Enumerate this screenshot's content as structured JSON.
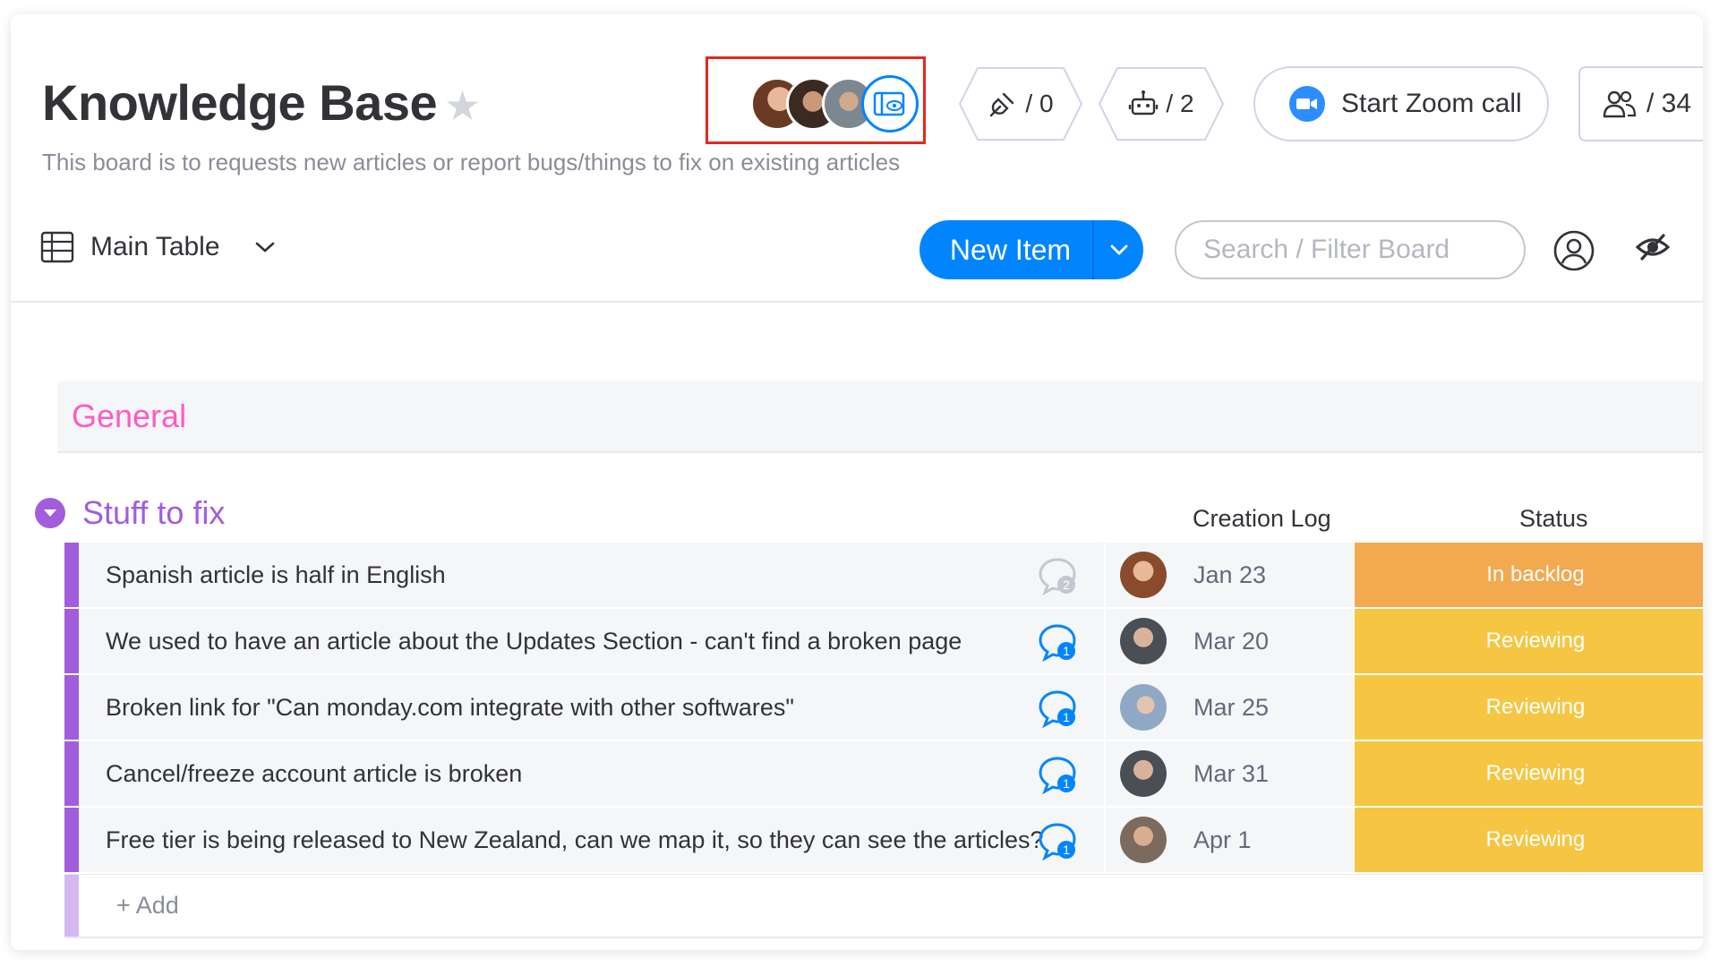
{
  "board": {
    "title": "Knowledge Base",
    "description": "This board is to requests new articles or report bugs/things to fix on existing articles"
  },
  "header": {
    "integrations_count": "/ 0",
    "automations_count": "/ 2",
    "zoom_label": "Start Zoom call",
    "members_count": "/ 34"
  },
  "toolbar": {
    "view_label": "Main Table",
    "new_item_label": "New Item",
    "search_placeholder": "Search / Filter Board"
  },
  "groups": {
    "general": {
      "title": "General"
    },
    "stuff": {
      "title": "Stuff to fix",
      "columns": [
        "Creation Log",
        "Status"
      ],
      "add_label": "+ Add",
      "items": [
        {
          "name": "Spanish article is half in English",
          "updates": "2",
          "date": "Jan 23",
          "status": "In backlog"
        },
        {
          "name": "We used to have an article about the Updates Section - can't find a broken page",
          "updates": "1",
          "date": "Mar 20",
          "status": "Reviewing"
        },
        {
          "name": "Broken link for \"Can monday.com integrate with other softwares\"",
          "updates": "1",
          "date": "Mar 25",
          "status": "Reviewing"
        },
        {
          "name": "Cancel/freeze account article is broken",
          "updates": "1",
          "date": "Mar 31",
          "status": "Reviewing"
        },
        {
          "name": "Free tier is being released to New Zealand, can we map it, so they can see the articles?",
          "updates": "1",
          "date": "Apr 1",
          "status": "Reviewing"
        }
      ]
    }
  },
  "colors": {
    "primary": "#0085ff",
    "group_purple": "#a25ddc",
    "general_pink": "#ff5ac4",
    "status_backlog": "#f3a94f",
    "status_reviewing": "#f6c643",
    "highlight_box": "#e3281e"
  },
  "icons": {
    "star": "star-icon",
    "viewers": "eye-icon",
    "integrations": "plug-icon",
    "automations": "robot-icon",
    "zoom": "zoom-camera-icon",
    "members": "people-icon",
    "table": "table-icon",
    "chevron": "chevron-down-icon",
    "person_filter": "person-circle-icon",
    "hide": "eye-off-icon",
    "updates": "speech-bubble-icon"
  }
}
